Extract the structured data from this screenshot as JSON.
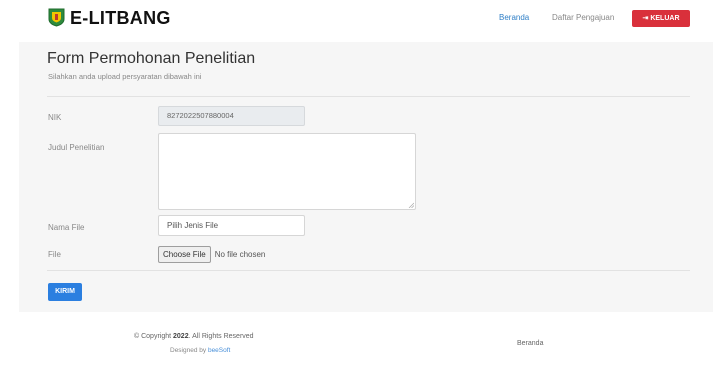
{
  "navbar": {
    "brand": "E-LITBANG",
    "links": {
      "beranda": "Beranda",
      "daftar": "Daftar Pengajuan"
    },
    "logout_label": "KELUAR",
    "logout_color": "#d9303b",
    "link_color": "#2f7fc7"
  },
  "form": {
    "title": "Form Permohonan Penelitian",
    "subtitle": "Silahkan anda upload persyaratan dibawah ini",
    "nik_label": "NIK",
    "nik_value": "8272022507880004",
    "judul_label": "Judul Penelitian",
    "judul_value": "",
    "nama_file_label": "Nama File",
    "nama_file_value": "Pilih Jenis File",
    "file_label": "File",
    "file_button": "Choose File",
    "file_status": "No file chosen",
    "submit_label": "KIRIM",
    "submit_color": "#2b7fe0"
  },
  "footer": {
    "copyright_prefix": "© Copyright ",
    "copyright_year": "2022",
    "copyright_suffix": ". All Rights Reserved",
    "designed_prefix": "Designed by ",
    "designed_link": "beeSoft",
    "beranda": "Beranda"
  },
  "icons": {
    "logo": "emblem-logo-icon",
    "logout": "logout-icon",
    "resize": "resize-handle-icon"
  }
}
